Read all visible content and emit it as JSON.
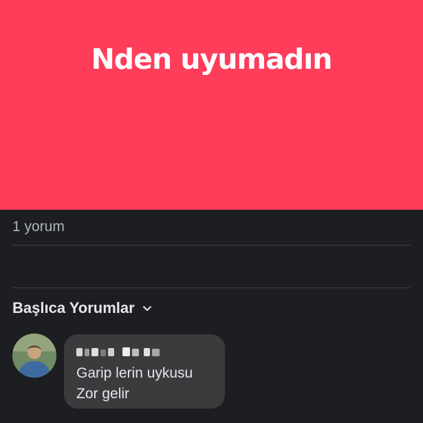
{
  "post": {
    "text": "Nden uyumadın",
    "background_color": "#fe3d5b"
  },
  "comments_meta": {
    "count_text": "1 yorum",
    "sort_label": "Başlıca Yorumlar",
    "sort_icon": "chevron-down-icon"
  },
  "comments": [
    {
      "author_name_redacted": true,
      "text_line_1": "Garip lerin uykusu",
      "text_line_2": "Zor gelir"
    }
  ],
  "colors": {
    "page_background": "#1c1e21",
    "bubble_background": "#3a3b3c",
    "primary_text": "#e4e6eb",
    "secondary_text": "#b0b3b8"
  }
}
